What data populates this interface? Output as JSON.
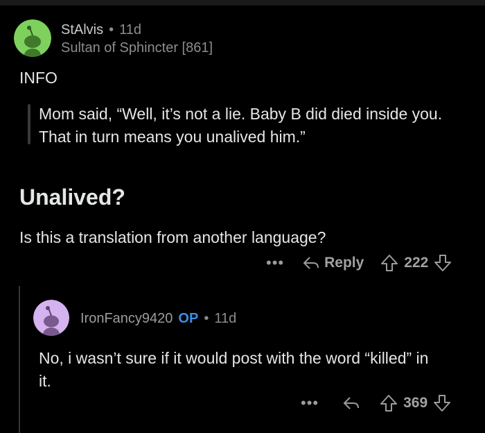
{
  "comment1": {
    "username": "StAlvis",
    "separator": "•",
    "age": "11d",
    "flair": "Sultan of Sphincter [861]",
    "line_info": "INFO",
    "quote": "Mom said, “Well, it’s not a lie. Baby B did died inside you. That in turn means you unalived him.”",
    "heading": "Unalived?",
    "question": "Is this a translation from another language?",
    "more": "•••",
    "reply_label": "Reply",
    "votes": "222",
    "avatar_color": "#7fd15e"
  },
  "comment2": {
    "username": "IronFancy9420",
    "op_badge": "OP",
    "separator": "•",
    "age": "11d",
    "text": "No, i wasn’t sure if it would post with the word “killed” in it.",
    "more": "•••",
    "votes": "369",
    "avatar_color": "#d4b3f0"
  }
}
